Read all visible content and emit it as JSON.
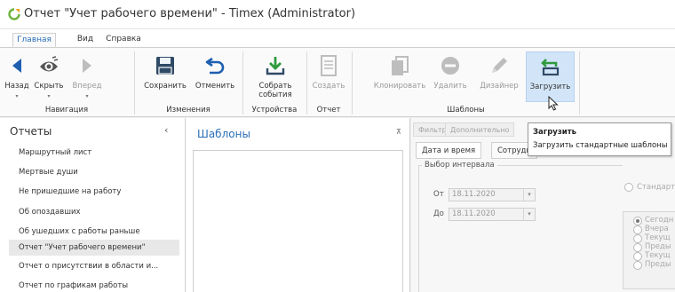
{
  "window": {
    "title": "Отчет \"Учет рабочего времени\" - Timex (Administrator)"
  },
  "menu": {
    "tabs": [
      "Главная",
      "Вид",
      "Справка"
    ]
  },
  "ribbon": {
    "buttons": {
      "back": "Назад",
      "hide": "Скрыть",
      "forward": "Вперед",
      "save": "Сохранить",
      "undo": "Отменить",
      "collect": "Собрать события",
      "create": "Создать",
      "clone": "Клонировать",
      "delete": "Удалить",
      "designer": "Дизайнер",
      "load": "Загрузить"
    },
    "groups": {
      "navigation": "Навигация",
      "changes": "Изменения",
      "devices": "Устройства",
      "report": "Отчет",
      "templates": "Шаблоны"
    },
    "dropdown_mark": "▾"
  },
  "reports": {
    "title": "Отчеты",
    "collapse": "‹",
    "items": [
      "Маршрутный лист",
      "Мертвые души",
      "Не пришедшие на работу",
      "Об опоздавших",
      "Об ушедших с работы раньше",
      "Отчет \"Учет рабочего времени\"",
      "Отчет о присутствии в области и...",
      "Отчет по графикам работы"
    ],
    "selected_index": 5
  },
  "templates": {
    "title": "Шаблоны",
    "pin": "⊼"
  },
  "params": {
    "tabs": [
      "Фильтр",
      "Дополнительно"
    ],
    "subtabs": [
      "Дата и время",
      "Сотрудн"
    ],
    "interval_legend": "Выбор интервала",
    "from_label": "От",
    "to_label": "До",
    "from_value": "18.11.2020",
    "to_value": "18.11.2020",
    "standard_label": "Стандартн",
    "options": [
      "Сегодн",
      "Вчера",
      "Текущ",
      "Преды",
      "Текущ",
      "Преды"
    ]
  },
  "tooltip": {
    "title": "Загрузить",
    "text": "Загрузить стандартные шаблоны"
  },
  "colors": {
    "accent": "#2a6fb8",
    "nav_arrow": "#1f5fb0",
    "logo_green": "#6db33f",
    "logo_orange": "#f0a020"
  }
}
